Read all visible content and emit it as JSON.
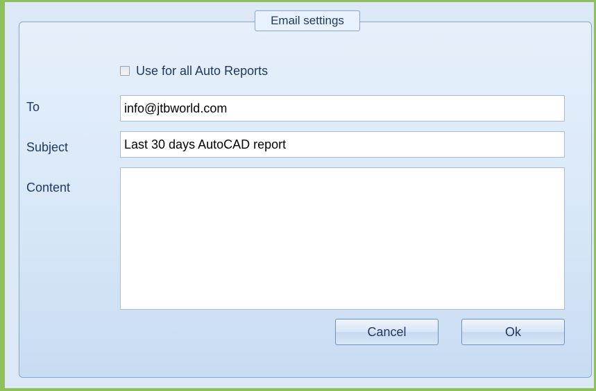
{
  "dialog": {
    "group_title": "Email settings",
    "use_for_all": {
      "label": "Use for all Auto Reports",
      "checked": false
    },
    "fields": {
      "to": {
        "label": "To",
        "value": "info@jtbworld.com"
      },
      "subject": {
        "label": "Subject",
        "value": "Last 30 days AutoCAD report"
      },
      "content": {
        "label": "Content",
        "value": ""
      }
    },
    "buttons": {
      "cancel": "Cancel",
      "ok": "Ok"
    }
  },
  "colors": {
    "window_border": "#8fc15a",
    "panel_background": "#dce8f6",
    "label_text": "#1e3a63"
  }
}
